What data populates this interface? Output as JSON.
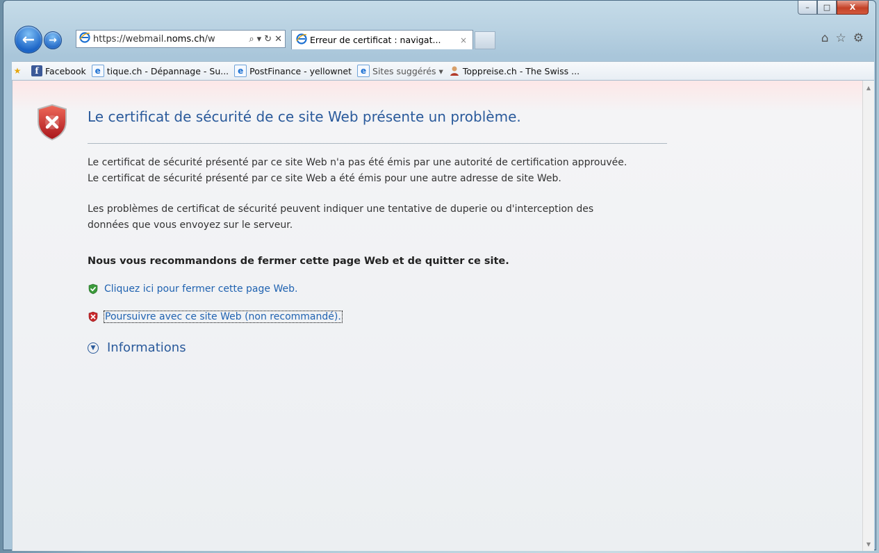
{
  "window": {
    "caption": {
      "minimize": "–",
      "maximize": "□",
      "close": "X"
    }
  },
  "toolbar": {
    "address_prefix": "https://webmail.",
    "address_domain": "noms.ch",
    "address_suffix": "/w",
    "search_icon": "⌕",
    "dropdown_icon": "▾",
    "refresh_icon": "↻",
    "stop_icon": "✕"
  },
  "tab": {
    "title": "Erreur de certificat : navigat...",
    "close_icon": "×"
  },
  "favorites": [
    {
      "label": "Facebook",
      "icon": "facebook-icon"
    },
    {
      "label": "tique.ch - Dépannage - Su...",
      "icon": "ie-page-icon"
    },
    {
      "label": "PostFinance - yellownet",
      "icon": "ie-page-icon"
    },
    {
      "label": "Sites suggérés ▾",
      "icon": "ie-page-icon"
    },
    {
      "label": "Toppreise.ch - The Swiss ...",
      "icon": "toppreise-icon"
    }
  ],
  "page": {
    "title": "Le certificat de sécurité de ce site Web présente un problème.",
    "para1_line1": "Le certificat de sécurité présenté par ce site Web n'a pas été émis par une autorité de certification approuvée.",
    "para1_line2": "Le certificat de sécurité présenté par ce site Web a été émis pour une autre adresse de site Web.",
    "para2_line1": "Les problèmes de certificat de sécurité peuvent indiquer une tentative de duperie ou d'interception des",
    "para2_line2": "données que vous envoyez sur le serveur.",
    "recommendation": "Nous vous recommandons de fermer cette page Web et de quitter ce site.",
    "close_link": "Cliquez ici pour fermer cette page Web.",
    "continue_link": "Poursuivre avec ce site Web (non recommandé).",
    "info_label": "Informations"
  },
  "colors": {
    "title": "#2a5a9b",
    "link": "#1f62b0",
    "shield_red": "#c8282b",
    "shield_green": "#3a9a3a"
  }
}
